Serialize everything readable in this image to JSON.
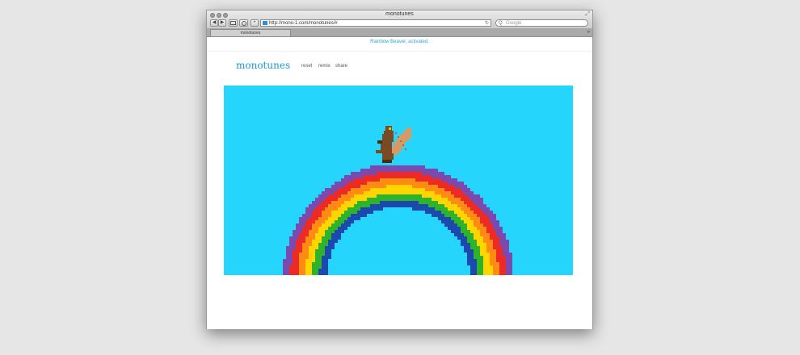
{
  "browser": {
    "window_title": "monotunes",
    "url": "http://mono-1.com/monotunes/#",
    "search_placeholder": "Google",
    "tab_label": "monotunes",
    "back_glyph": "◀",
    "forward_glyph": "▶",
    "add_glyph": "+",
    "reload_glyph": "↻",
    "search_glyph": "Q",
    "tab_overflow_glyph": "»",
    "resize_glyph": "⤢"
  },
  "page": {
    "notice": "Rainbow Beaver, activated.",
    "logo": "monotunes",
    "nav": [
      "reset",
      "remix",
      "share"
    ]
  },
  "scene": {
    "sky_color": "#25d5fb",
    "rainbow_colors": [
      "#7b4ab0",
      "#ee2a24",
      "#ff8a14",
      "#ffd500",
      "#2db42b",
      "#1c49ae"
    ],
    "beaver_color": "#7a4a23",
    "tail_color": "#d69a66"
  }
}
